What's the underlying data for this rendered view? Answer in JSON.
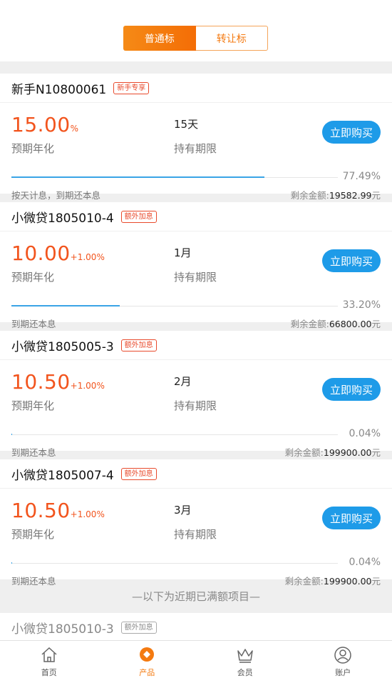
{
  "segment": {
    "active_label": "普通标",
    "inactive_label": "转让标"
  },
  "products": [
    {
      "name": "新手N10800061",
      "tag": "新手专享",
      "rate": "15.00",
      "rate_unit": "%",
      "rate_label": "预期年化",
      "period": "15天",
      "period_label": "持有期限",
      "buy_label": "立即购买",
      "progress_pct": 77.49,
      "progress_text": "77.49%",
      "repay_text": "按天计息，到期还本息",
      "remain_label": "剩余金额:",
      "remain_value": "19582.99",
      "remain_unit": "元"
    },
    {
      "name": "小微贷1805010-4",
      "tag": "额外加息",
      "rate": "10.00",
      "rate_unit": "+1.00%",
      "rate_label": "预期年化",
      "period": "1月",
      "period_label": "持有期限",
      "buy_label": "立即购买",
      "progress_pct": 33.2,
      "progress_text": "33.20%",
      "repay_text": "到期还本息",
      "remain_label": "剩余金额:",
      "remain_value": "66800.00",
      "remain_unit": "元"
    },
    {
      "name": "小微贷1805005-3",
      "tag": "额外加息",
      "rate": "10.50",
      "rate_unit": "+1.00%",
      "rate_label": "预期年化",
      "period": "2月",
      "period_label": "持有期限",
      "buy_label": "立即购买",
      "progress_pct": 0.04,
      "progress_text": "0.04%",
      "repay_text": "到期还本息",
      "remain_label": "剩余金额:",
      "remain_value": "199900.00",
      "remain_unit": "元"
    },
    {
      "name": "小微贷1805007-4",
      "tag": "额外加息",
      "rate": "10.50",
      "rate_unit": "+1.00%",
      "rate_label": "预期年化",
      "period": "3月",
      "period_label": "持有期限",
      "buy_label": "立即购买",
      "progress_pct": 0.04,
      "progress_text": "0.04%",
      "repay_text": "到期还本息",
      "remain_label": "剩余金额:",
      "remain_value": "199900.00",
      "remain_unit": "元"
    }
  ],
  "notice": "—以下为近期已满额项目—",
  "partial_item": {
    "name": "小微贷1805010-3",
    "tag": "额外加息"
  },
  "tabbar": [
    {
      "label": "首页",
      "icon": "home-icon",
      "active": false
    },
    {
      "label": "产品",
      "icon": "product-icon",
      "active": true
    },
    {
      "label": "会员",
      "icon": "crown-icon",
      "active": false
    },
    {
      "label": "账户",
      "icon": "account-icon",
      "active": false
    }
  ],
  "colors": {
    "accent": "#f47a10",
    "rate": "#f2541d",
    "button": "#1e9be8",
    "progress": "#3aa4e6"
  }
}
